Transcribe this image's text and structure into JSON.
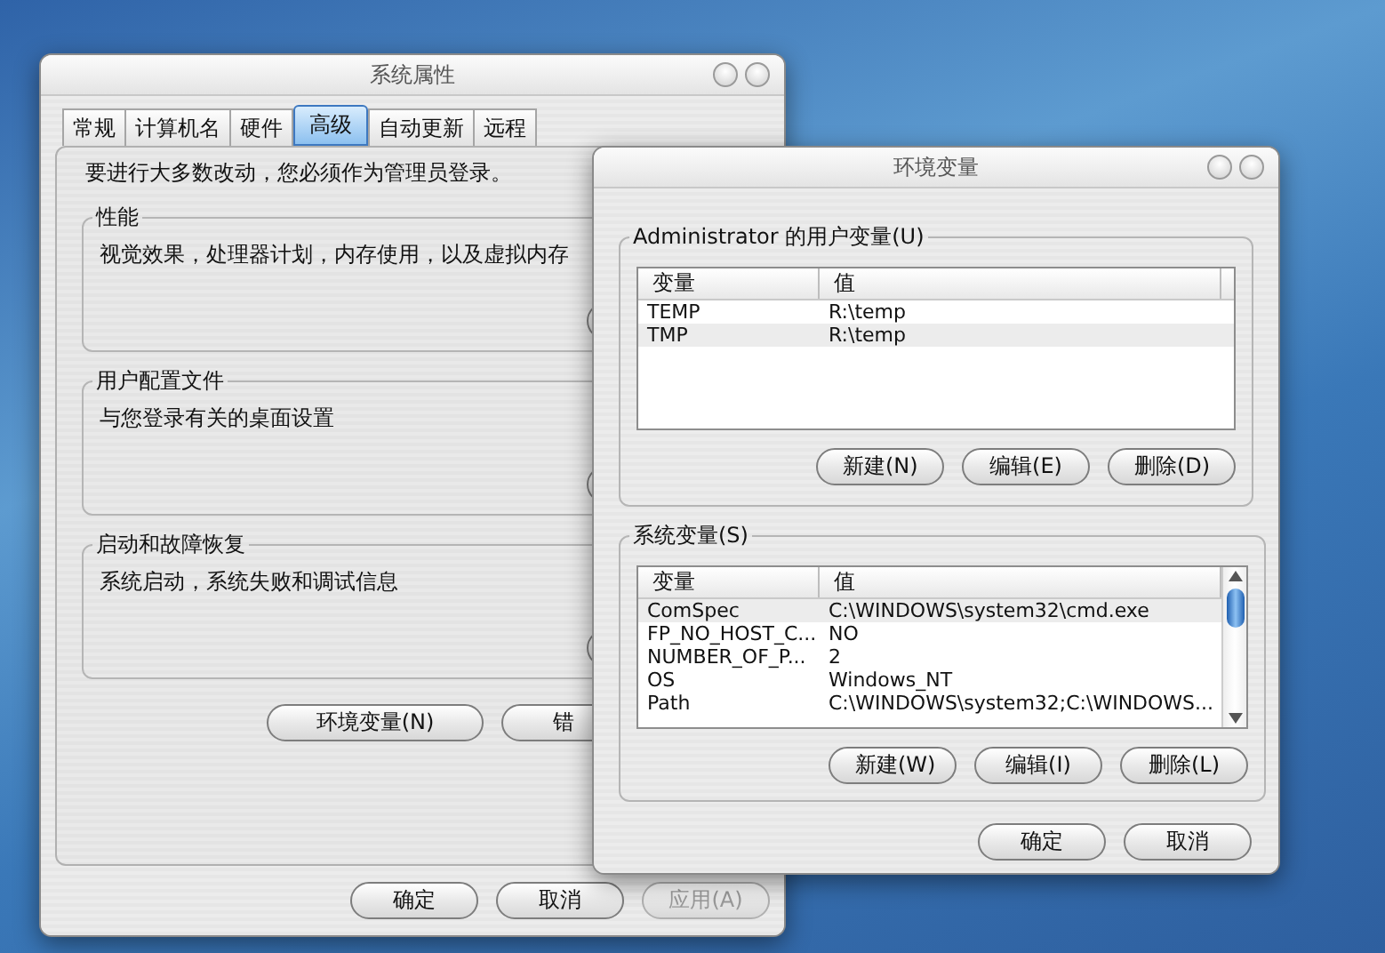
{
  "back_window": {
    "title": "系统属性",
    "tabs": [
      {
        "label": "常规",
        "selected": false
      },
      {
        "label": "计算机名",
        "selected": false
      },
      {
        "label": "硬件",
        "selected": false
      },
      {
        "label": "高级",
        "selected": true
      },
      {
        "label": "自动更新",
        "selected": false
      },
      {
        "label": "远程",
        "selected": false
      }
    ],
    "note": "要进行大多数改动，您必须作为管理员登录。",
    "groups": [
      {
        "title": "性能",
        "description": "视觉效果，处理器计划，内存使用，以及虚拟内存"
      },
      {
        "title": "用户配置文件",
        "description": "与您登录有关的桌面设置"
      },
      {
        "title": "启动和故障恢复",
        "description": "系统启动，系统失败和调试信息"
      }
    ],
    "buttons": [
      {
        "label": "环境变量(N)"
      },
      {
        "label": "错"
      }
    ],
    "dialog_buttons": [
      {
        "label": "确定",
        "disabled": false
      },
      {
        "label": "取消",
        "disabled": false
      },
      {
        "label": "应用(A)",
        "disabled": true
      }
    ]
  },
  "front_window": {
    "title": "环境变量",
    "user_variables": {
      "title": "Administrator 的用户变量(U)",
      "columns": [
        "变量",
        "值"
      ],
      "rows": [
        {
          "variable": "TEMP",
          "value": "R:\\temp",
          "selected": false
        },
        {
          "variable": "TMP",
          "value": "R:\\temp",
          "selected": true
        }
      ],
      "buttons": [
        "新建(N)",
        "编辑(E)",
        "删除(D)"
      ]
    },
    "system_variables": {
      "title": "系统变量(S)",
      "columns": [
        "变量",
        "值"
      ],
      "rows": [
        {
          "variable": "ComSpec",
          "value": "C:\\WINDOWS\\system32\\cmd.exe",
          "selected": true
        },
        {
          "variable": "FP_NO_HOST_C...",
          "value": "NO",
          "selected": false
        },
        {
          "variable": "NUMBER_OF_P...",
          "value": "2",
          "selected": false
        },
        {
          "variable": "OS",
          "value": "Windows_NT",
          "selected": false
        },
        {
          "variable": "Path",
          "value": "C:\\WINDOWS\\system32;C:\\WINDOWS...",
          "selected": false
        }
      ],
      "buttons": [
        "新建(W)",
        "编辑(I)",
        "删除(L)"
      ]
    },
    "buttons": [
      "确定",
      "取消"
    ]
  }
}
